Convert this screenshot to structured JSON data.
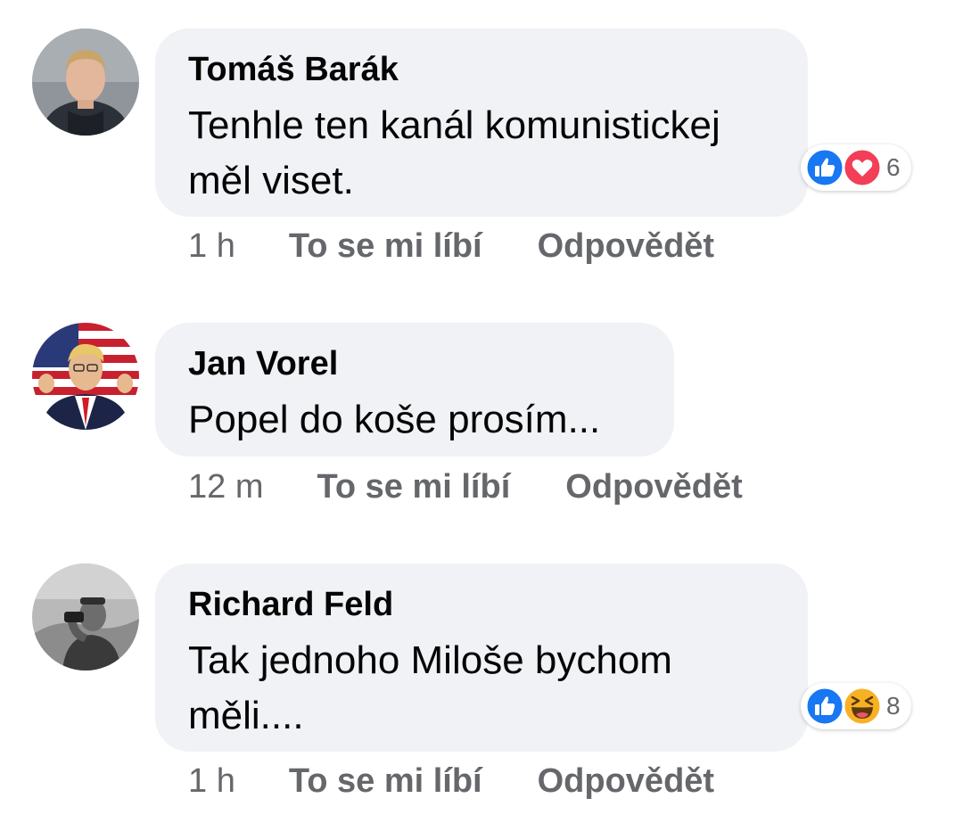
{
  "comments": [
    {
      "author": "Tomáš Barák",
      "text": "Tenhle ten kanál komunistickej měl viset.",
      "time": "1 h",
      "like_label": "To se mi líbí",
      "reply_label": "Odpovědět",
      "reactions": {
        "icons": [
          "like-icon",
          "love-icon"
        ],
        "count": "6"
      }
    },
    {
      "author": "Jan Vorel",
      "text": "Popel do koše prosím...",
      "time": "12 m",
      "like_label": "To se mi líbí",
      "reply_label": "Odpovědět"
    },
    {
      "author": "Richard Feld",
      "text": "Tak jednoho Miloše bychom měli....",
      "time": "1 h",
      "like_label": "To se mi líbí",
      "reply_label": "Odpovědět",
      "reactions": {
        "icons": [
          "like-icon",
          "haha-icon"
        ],
        "count": "8"
      }
    }
  ],
  "colors": {
    "bubble": "#f0f2f5",
    "meta_text": "#65676b",
    "like_blue": "#1877f2",
    "love_red": "#f33e58",
    "haha_yellow": "#f7b125"
  }
}
